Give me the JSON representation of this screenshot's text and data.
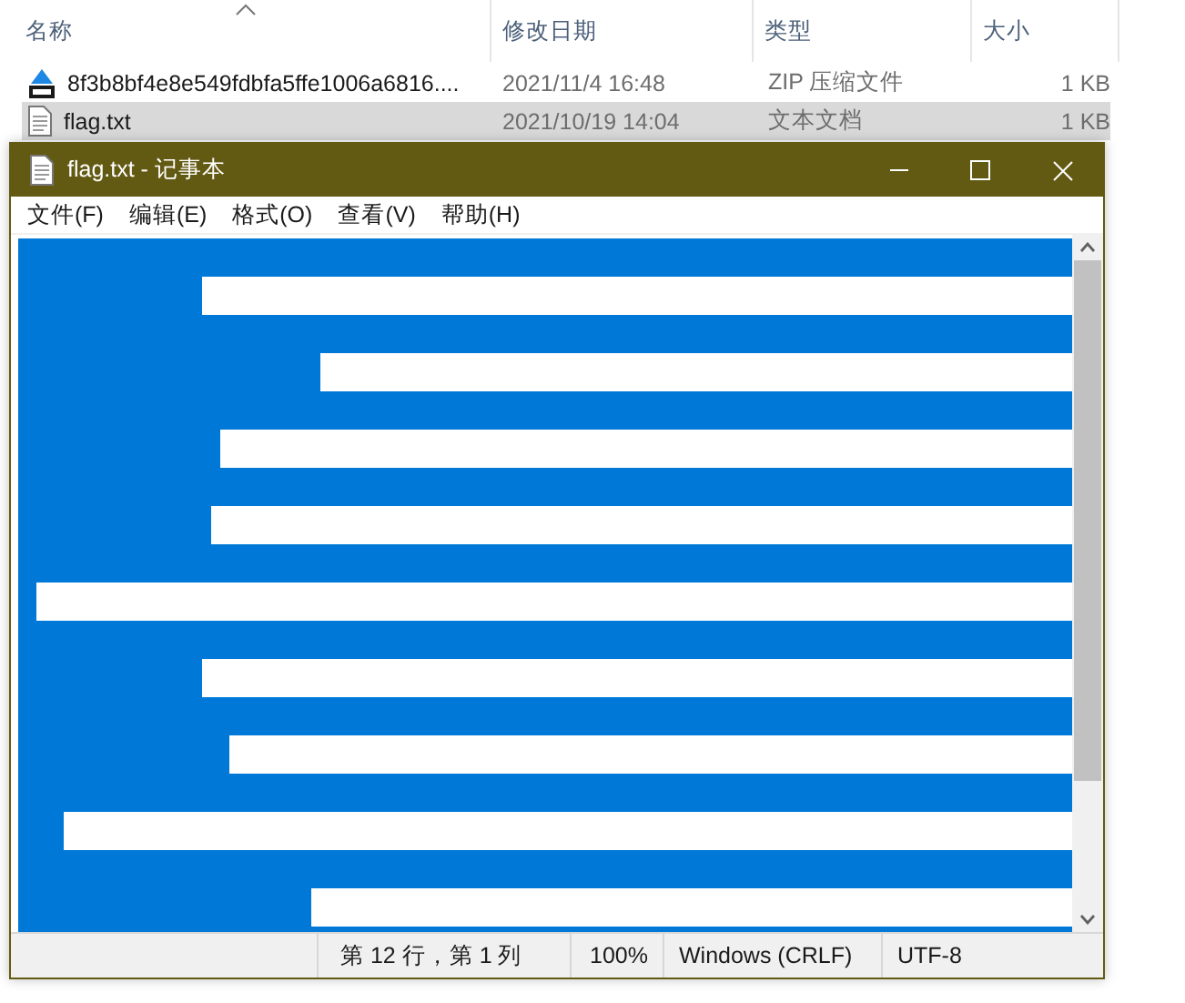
{
  "explorer": {
    "columns": [
      {
        "label": "名称",
        "sorted": true
      },
      {
        "label": "修改日期",
        "sorted": false
      },
      {
        "label": "类型",
        "sorted": false
      },
      {
        "label": "大小",
        "sorted": false
      }
    ],
    "files": [
      {
        "name": "8f3b8bf4e8e549fdbfa5ffe1006a6816....",
        "modified": "2021/11/4 16:48",
        "type": "ZIP 压缩文件",
        "size": "1 KB",
        "kind": "zip",
        "selected": false
      },
      {
        "name": "flag.txt",
        "modified": "2021/10/19 14:04",
        "type": "文本文档",
        "size": "1 KB",
        "kind": "text",
        "selected": true
      }
    ]
  },
  "notepad": {
    "title": "flag.txt - 记事本",
    "menu": [
      "文件(F)",
      "编辑(E)",
      "格式(O)",
      "查看(V)",
      "帮助(H)"
    ],
    "lines": [
      {
        "level": 1
      },
      {
        "level": 0.174
      },
      {
        "level": 1
      },
      {
        "level": 0.287
      },
      {
        "level": 1
      },
      {
        "level": 0.191
      },
      {
        "level": 1
      },
      {
        "level": 0.183
      },
      {
        "level": 1
      },
      {
        "level": 0.017
      },
      {
        "level": 1
      },
      {
        "level": 0.174
      },
      {
        "level": 1
      },
      {
        "level": 0.2
      },
      {
        "level": 1
      },
      {
        "level": 0.043
      },
      {
        "level": 1
      },
      {
        "level": 0.278
      },
      {
        "level": 1
      }
    ],
    "status": {
      "position": "第 12 行，第 1 列",
      "zoom": "100%",
      "line_ending": "Windows (CRLF)",
      "encoding": "UTF-8"
    }
  }
}
